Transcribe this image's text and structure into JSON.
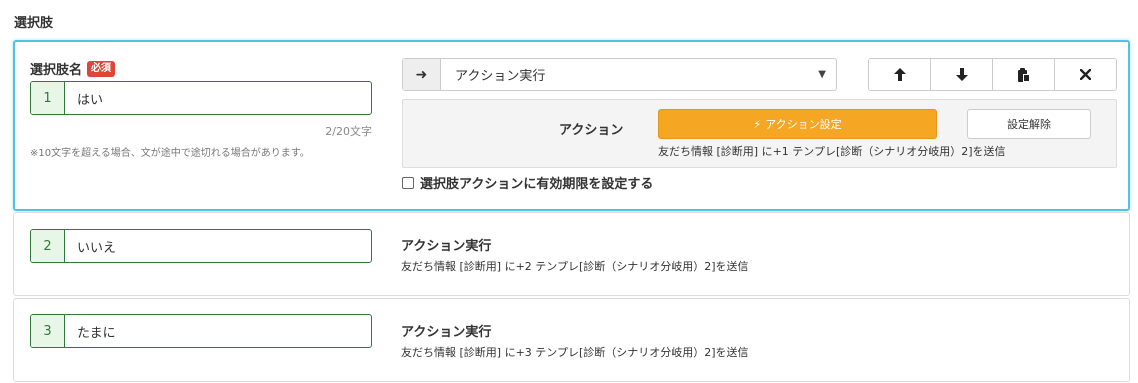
{
  "section": {
    "title": "選択肢"
  },
  "choice_editor": {
    "name_label": "選択肢名",
    "required_badge": "必須",
    "counter": "2/20文字",
    "note": "※10文字を超える場合、文が途中で途切れる場合があります。",
    "selected_action_type": "アクション実行",
    "buttons": {
      "up_icon": "arrow-up-icon",
      "down_icon": "arrow-down-icon",
      "copy_icon": "clipboard-icon",
      "delete_icon": "close-icon"
    },
    "action_label": "アクション",
    "action_setting_label": "アクション設定",
    "action_clear_label": "設定解除",
    "expiry_label": "選択肢アクションに有効期限を設定する",
    "accent_color": "#4fc3e6",
    "action_button_color": "#f5a623"
  },
  "choices": [
    {
      "number": "1",
      "value": "はい",
      "action_desc": "友だち情報 [診断用] に+1 テンプレ[診断（シナリオ分岐用）2]を送信"
    },
    {
      "number": "2",
      "value": "いいえ",
      "action_title": "アクション実行",
      "action_desc": "友だち情報 [診断用] に+2 テンプレ[診断（シナリオ分岐用）2]を送信"
    },
    {
      "number": "3",
      "value": "たまに",
      "action_title": "アクション実行",
      "action_desc": "友だち情報 [診断用] に+3 テンプレ[診断（シナリオ分岐用）2]を送信"
    }
  ]
}
